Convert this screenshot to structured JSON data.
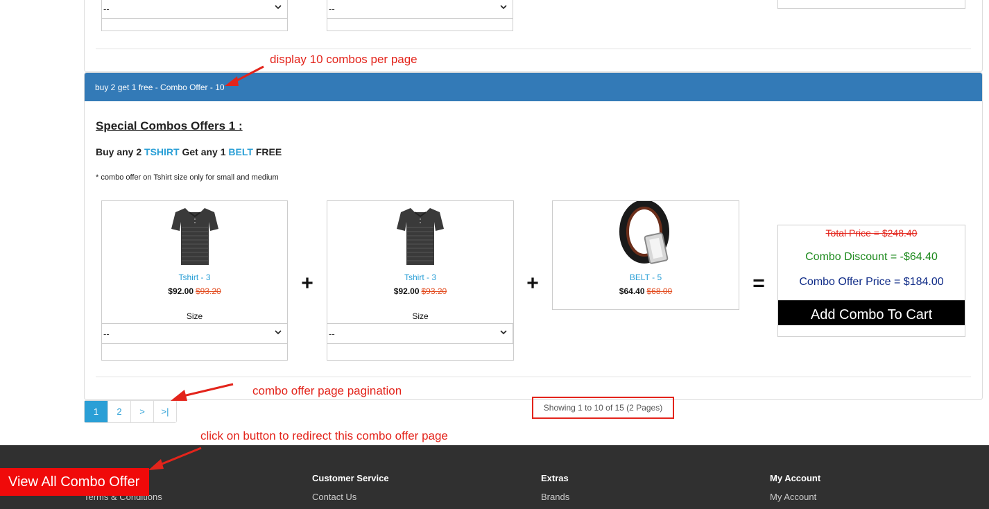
{
  "prev_panel": {
    "select_left": "--",
    "select_right": "--"
  },
  "panel": {
    "header": "buy 2 get 1 free - Combo Offer - 10",
    "title": "Special Combos Offers 1 :",
    "offer": {
      "prefix": "Buy any 2",
      "item_a": "TSHIRT",
      "middle": "Get any 1",
      "item_b": "BELT",
      "suffix": "FREE"
    },
    "note": "* combo offer on Tshirt size only for small and medium",
    "products": [
      {
        "name": "Tshirt - 3",
        "price": "$92.00",
        "old_price": "$93.20",
        "size_label": "Size",
        "size_value": "--"
      },
      {
        "name": "Tshirt - 3",
        "price": "$92.00",
        "old_price": "$93.20",
        "size_label": "Size",
        "size_value": "--"
      },
      {
        "name": "BELT - 5",
        "price": "$64.40",
        "old_price": "$68.00"
      }
    ],
    "operators": {
      "plus": "+",
      "equals": "="
    },
    "summary": {
      "total": "Total Price = $248.40",
      "discount": "Combo Discount = -$64.40",
      "offer_price": "Combo Offer Price = $184.00",
      "button": "Add Combo To Cart"
    }
  },
  "pagination": {
    "pages": [
      "1",
      "2",
      ">",
      ">|"
    ],
    "active": "1",
    "showing": "Showing 1 to 10 of 15 (2 Pages)"
  },
  "annotations": {
    "per_page": "display 10 combos per page",
    "pagination": "combo offer page pagination",
    "redirect": "click on button to redirect this combo offer page"
  },
  "view_all_button": "View All Combo Offer",
  "footer": {
    "col1_link": "Terms & Conditions",
    "col2": {
      "heading": "Customer Service",
      "link": "Contact Us"
    },
    "col3": {
      "heading": "Extras",
      "link": "Brands"
    },
    "col4": {
      "heading": "My Account",
      "link": "My Account"
    }
  },
  "colors": {
    "panel_header": "#337ab7",
    "accent": "#2a9fd6",
    "annotation": "#e3241b",
    "discount": "#1e8a1e",
    "offer_price": "#0f2b87",
    "footer_bg": "#303030",
    "view_all_bg": "#f00a0a"
  }
}
